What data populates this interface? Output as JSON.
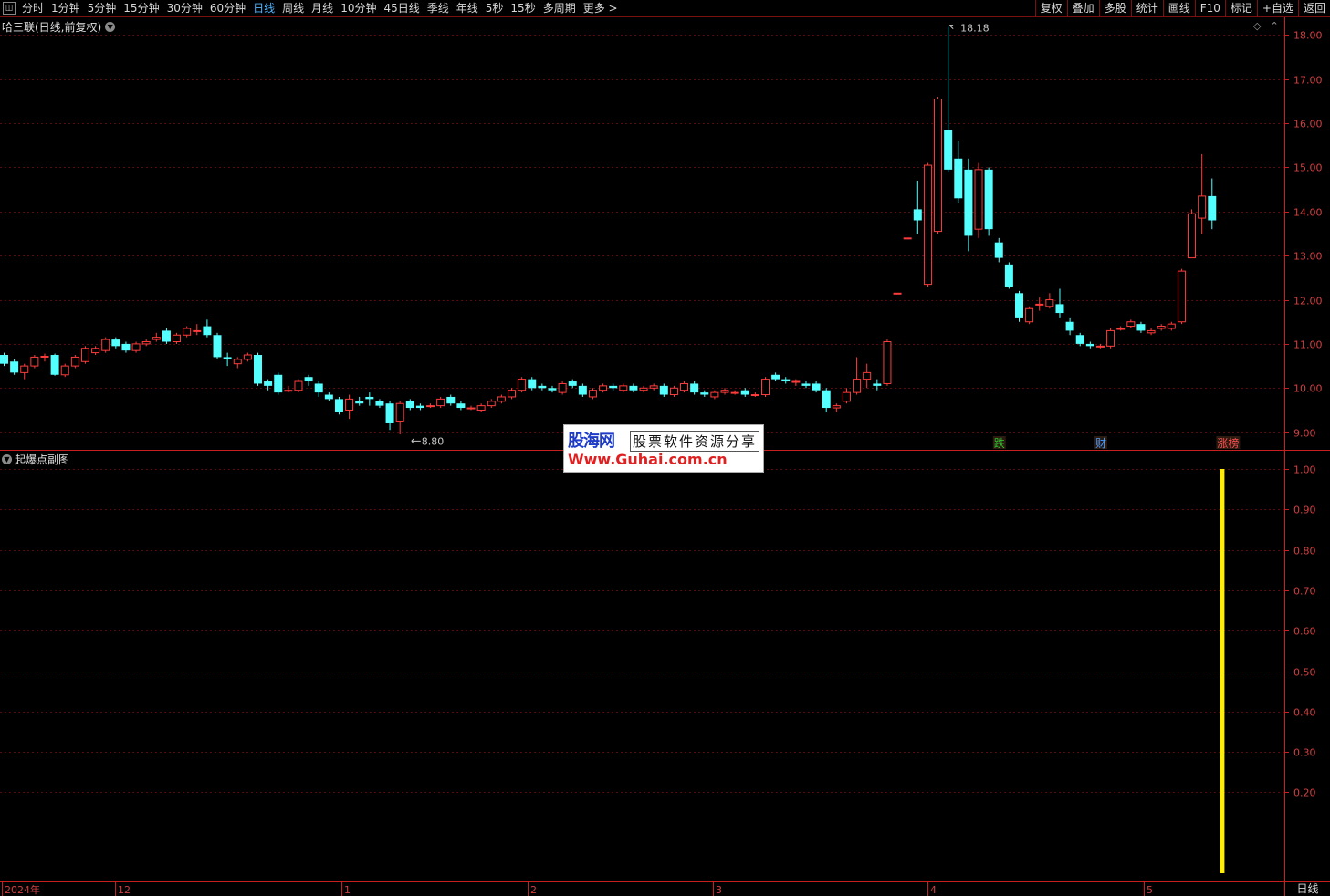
{
  "toolbar": {
    "periods": [
      "分时",
      "1分钟",
      "5分钟",
      "15分钟",
      "30分钟",
      "60分钟",
      "日线",
      "周线",
      "月线",
      "10分钟",
      "45日线",
      "季线",
      "年线",
      "5秒",
      "15秒",
      "多周期",
      "更多 >"
    ],
    "active_period": "日线",
    "right_tools": [
      "复权",
      "叠加",
      "多股",
      "统计",
      "画线",
      "F10",
      "标记",
      "+自选",
      "返回"
    ]
  },
  "main_panel": {
    "title": "哈三联(日线,前复权)",
    "price_axis": [
      "18.00",
      "17.00",
      "16.00",
      "15.00",
      "14.00",
      "13.00",
      "12.00",
      "11.00",
      "10.00",
      "9.00"
    ],
    "high_marker": "18.18",
    "low_marker": "8.80",
    "events": [
      {
        "text": "跌",
        "color": "#2ec02e"
      },
      {
        "text": "财",
        "color": "#4a9cff"
      },
      {
        "text": "涨榜",
        "color": "#ff5050"
      }
    ]
  },
  "sub_panel": {
    "title": "起爆点副图",
    "value_axis": [
      "1.00",
      "0.90",
      "0.80",
      "0.70",
      "0.60",
      "0.50",
      "0.40",
      "0.30",
      "0.20"
    ],
    "signal_color": "#ffee00"
  },
  "date_axis": [
    "2024年",
    "12",
    "1",
    "2",
    "3",
    "4",
    "5"
  ],
  "period_label": "日线",
  "watermark": {
    "brand": "股海网",
    "tagline": "股票软件资源分享",
    "url": "Www.Guhai.com.cn"
  },
  "colors": {
    "up": "#ff3c3c",
    "down": "#54ffff",
    "grid": "#5a0c0c",
    "axis": "#c82020"
  },
  "chart_data": {
    "type": "candlestick",
    "price_range": [
      8.6,
      18.4
    ],
    "candles": [
      [
        10.75,
        10.55,
        10.8,
        10.5
      ],
      [
        10.6,
        10.35,
        10.65,
        10.3
      ],
      [
        10.35,
        10.5,
        10.55,
        10.2
      ],
      [
        10.5,
        10.7,
        10.75,
        10.45
      ],
      [
        10.7,
        10.72,
        10.78,
        10.6
      ],
      [
        10.75,
        10.3,
        10.78,
        10.28
      ],
      [
        10.3,
        10.5,
        10.55,
        10.25
      ],
      [
        10.5,
        10.7,
        10.75,
        10.45
      ],
      [
        10.6,
        10.9,
        10.95,
        10.55
      ],
      [
        10.8,
        10.9,
        10.95,
        10.75
      ],
      [
        10.85,
        11.1,
        11.15,
        10.8
      ],
      [
        11.1,
        10.95,
        11.15,
        10.9
      ],
      [
        11.0,
        10.85,
        11.05,
        10.8
      ],
      [
        10.85,
        11.0,
        11.05,
        10.8
      ],
      [
        11.0,
        11.05,
        11.1,
        10.95
      ],
      [
        11.1,
        11.15,
        11.25,
        11.05
      ],
      [
        11.3,
        11.05,
        11.35,
        11.0
      ],
      [
        11.05,
        11.2,
        11.25,
        11.0
      ],
      [
        11.2,
        11.35,
        11.4,
        11.15
      ],
      [
        11.3,
        11.3,
        11.45,
        11.2
      ],
      [
        11.4,
        11.2,
        11.55,
        11.15
      ],
      [
        11.2,
        10.7,
        11.25,
        10.65
      ],
      [
        10.7,
        10.65,
        10.8,
        10.5
      ],
      [
        10.55,
        10.65,
        10.7,
        10.45
      ],
      [
        10.65,
        10.75,
        10.8,
        10.6
      ],
      [
        10.75,
        10.1,
        10.8,
        10.05
      ],
      [
        10.15,
        10.05,
        10.2,
        9.95
      ],
      [
        10.3,
        9.9,
        10.35,
        9.85
      ],
      [
        9.95,
        9.95,
        10.05,
        9.9
      ],
      [
        9.95,
        10.15,
        10.2,
        9.9
      ],
      [
        10.25,
        10.15,
        10.3,
        10.05
      ],
      [
        10.1,
        9.9,
        10.15,
        9.8
      ],
      [
        9.85,
        9.75,
        9.9,
        9.7
      ],
      [
        9.75,
        9.45,
        9.8,
        9.4
      ],
      [
        9.5,
        9.75,
        9.85,
        9.3
      ],
      [
        9.7,
        9.65,
        9.8,
        9.6
      ],
      [
        9.8,
        9.75,
        9.9,
        9.6
      ],
      [
        9.7,
        9.6,
        9.75,
        9.55
      ],
      [
        9.65,
        9.2,
        9.7,
        9.05
      ],
      [
        9.25,
        9.65,
        9.7,
        8.95
      ],
      [
        9.7,
        9.55,
        9.75,
        9.5
      ],
      [
        9.6,
        9.55,
        9.65,
        9.5
      ],
      [
        9.6,
        9.6,
        9.65,
        9.55
      ],
      [
        9.6,
        9.75,
        9.8,
        9.55
      ],
      [
        9.8,
        9.65,
        9.85,
        9.6
      ],
      [
        9.65,
        9.55,
        9.7,
        9.5
      ],
      [
        9.55,
        9.55,
        9.6,
        9.5
      ],
      [
        9.5,
        9.6,
        9.65,
        9.45
      ],
      [
        9.6,
        9.7,
        9.75,
        9.55
      ],
      [
        9.7,
        9.8,
        9.85,
        9.65
      ],
      [
        9.8,
        9.95,
        10.0,
        9.75
      ],
      [
        9.95,
        10.2,
        10.25,
        9.9
      ],
      [
        10.2,
        10.0,
        10.25,
        9.95
      ],
      [
        10.05,
        10.0,
        10.1,
        9.95
      ],
      [
        10.0,
        9.95,
        10.05,
        9.9
      ],
      [
        9.9,
        10.1,
        10.15,
        9.85
      ],
      [
        10.15,
        10.05,
        10.2,
        10.0
      ],
      [
        10.05,
        9.85,
        10.1,
        9.8
      ],
      [
        9.8,
        9.95,
        10.0,
        9.75
      ],
      [
        9.95,
        10.05,
        10.1,
        9.9
      ],
      [
        10.05,
        10.0,
        10.1,
        9.95
      ],
      [
        9.95,
        10.05,
        10.1,
        9.9
      ],
      [
        10.05,
        9.95,
        10.1,
        9.9
      ],
      [
        9.95,
        10.0,
        10.05,
        9.9
      ],
      [
        10.0,
        10.05,
        10.1,
        9.95
      ],
      [
        10.05,
        9.85,
        10.1,
        9.8
      ],
      [
        9.85,
        10.0,
        10.05,
        9.8
      ],
      [
        9.95,
        10.1,
        10.15,
        9.9
      ],
      [
        10.1,
        9.9,
        10.15,
        9.85
      ],
      [
        9.9,
        9.85,
        9.95,
        9.8
      ],
      [
        9.8,
        9.9,
        9.95,
        9.75
      ],
      [
        9.9,
        9.95,
        10.0,
        9.85
      ],
      [
        9.9,
        9.9,
        9.95,
        9.85
      ],
      [
        9.95,
        9.85,
        10.0,
        9.8
      ],
      [
        9.85,
        9.85,
        9.9,
        9.8
      ],
      [
        9.85,
        10.2,
        10.25,
        9.8
      ],
      [
        10.3,
        10.2,
        10.35,
        10.15
      ],
      [
        10.2,
        10.15,
        10.25,
        10.1
      ],
      [
        10.15,
        10.15,
        10.2,
        10.05
      ],
      [
        10.1,
        10.05,
        10.15,
        10.0
      ],
      [
        10.1,
        9.95,
        10.15,
        9.9
      ],
      [
        9.95,
        9.55,
        10.0,
        9.45
      ],
      [
        9.55,
        9.6,
        9.65,
        9.45
      ],
      [
        9.7,
        9.9,
        10.0,
        9.65
      ],
      [
        9.9,
        10.2,
        10.7,
        9.85
      ],
      [
        10.2,
        10.35,
        10.55,
        10.0
      ],
      [
        10.1,
        10.05,
        10.2,
        9.95
      ],
      [
        10.1,
        11.05,
        11.1,
        10.05
      ],
      [
        12.15,
        12.15,
        12.15,
        12.15
      ],
      [
        13.4,
        13.4,
        13.4,
        13.4
      ],
      [
        14.05,
        13.8,
        14.7,
        13.5
      ],
      [
        12.35,
        15.05,
        15.1,
        12.3
      ],
      [
        13.55,
        16.55,
        16.6,
        13.5
      ],
      [
        15.85,
        14.95,
        18.18,
        14.9
      ],
      [
        15.2,
        14.3,
        15.6,
        14.2
      ],
      [
        14.95,
        13.45,
        15.2,
        13.1
      ],
      [
        13.6,
        14.95,
        15.1,
        13.4
      ],
      [
        14.95,
        13.6,
        15.0,
        13.45
      ],
      [
        13.3,
        12.95,
        13.4,
        12.85
      ],
      [
        12.8,
        12.3,
        12.85,
        12.25
      ],
      [
        12.15,
        11.6,
        12.2,
        11.5
      ],
      [
        11.5,
        11.8,
        11.85,
        11.45
      ],
      [
        11.9,
        11.9,
        12.05,
        11.75
      ],
      [
        11.85,
        12.0,
        12.15,
        11.8
      ],
      [
        11.9,
        11.7,
        12.25,
        11.6
      ],
      [
        11.5,
        11.3,
        11.6,
        11.2
      ],
      [
        11.2,
        11.0,
        11.25,
        10.95
      ],
      [
        11.0,
        10.95,
        11.05,
        10.9
      ],
      [
        10.95,
        10.95,
        11.0,
        10.9
      ],
      [
        10.95,
        11.3,
        11.35,
        10.9
      ],
      [
        11.35,
        11.35,
        11.4,
        11.3
      ],
      [
        11.4,
        11.5,
        11.55,
        11.35
      ],
      [
        11.45,
        11.3,
        11.5,
        11.25
      ],
      [
        11.25,
        11.3,
        11.35,
        11.2
      ],
      [
        11.35,
        11.4,
        11.45,
        11.3
      ],
      [
        11.35,
        11.45,
        11.5,
        11.3
      ],
      [
        11.5,
        12.65,
        12.7,
        11.45
      ],
      [
        12.95,
        13.95,
        14.05,
        12.95
      ],
      [
        13.85,
        14.35,
        15.3,
        13.5
      ],
      [
        14.35,
        13.8,
        14.75,
        13.6
      ]
    ],
    "sub_signal": {
      "candle_index": 120,
      "value": 1.0
    },
    "sub_range": [
      0.0,
      1.0
    ]
  }
}
